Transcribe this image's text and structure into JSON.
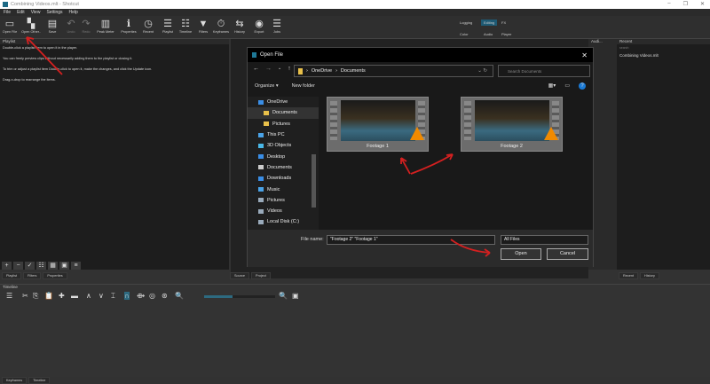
{
  "window": {
    "title": "Combining Videos.mlt - Shotcut",
    "controls": [
      "–",
      "❐",
      "✕"
    ]
  },
  "menu": [
    "File",
    "Edit",
    "View",
    "Settings",
    "Help"
  ],
  "toolbar": [
    {
      "label": "Open File",
      "icon": "▭"
    },
    {
      "label": "Open Other..",
      "icon": "▚"
    },
    {
      "label": "Save",
      "icon": "▤"
    },
    {
      "label": "Undo",
      "icon": "↶",
      "disabled": true
    },
    {
      "label": "Redo",
      "icon": "↷",
      "disabled": true
    },
    {
      "label": "Peak Meter",
      "icon": "▥"
    },
    {
      "label": "Properties",
      "icon": "ℹ"
    },
    {
      "label": "Recent",
      "icon": "◷"
    },
    {
      "label": "Playlist",
      "icon": "☰"
    },
    {
      "label": "Timeline",
      "icon": "☷"
    },
    {
      "label": "Filters",
      "icon": "▼"
    },
    {
      "label": "Keyframes",
      "icon": "⏱"
    },
    {
      "label": "History",
      "icon": "⇆"
    },
    {
      "label": "Export",
      "icon": "◉"
    },
    {
      "label": "Jobs",
      "icon": "☰"
    }
  ],
  "layouts": {
    "row1": [
      "Logging",
      "Editing",
      "FX"
    ],
    "row2": [
      "Color",
      "Audio",
      "Player"
    ],
    "active": "Editing",
    "accent": "#1e5a74"
  },
  "playlist": {
    "title": "Playlist",
    "help": [
      "Double-click a playlist item to open it in the player.",
      "You can freely preview clips without necessarily adding them to the playlist or closing it.",
      "To trim or adjust a playlist item Double-click to open it, make the changes, and click the Update icon.",
      "Drag-n-drop to rearrange the items."
    ],
    "buttons": [
      "+",
      "−",
      "✓",
      "☷",
      "▦",
      "▣",
      "≡"
    ],
    "tabs": [
      "Playlist",
      "Filters",
      "Properties"
    ]
  },
  "player": {
    "tabs": [
      "Source",
      "Project"
    ]
  },
  "audio": {
    "title": "Audi..."
  },
  "recent": {
    "title": "Recent",
    "search_placeholder": "search",
    "items": [
      "Combining Videos.mlt"
    ],
    "tabs": [
      "Recent",
      "History"
    ]
  },
  "timeline": {
    "title": "Timeline",
    "tools": [
      "☰",
      "✂",
      "⎘",
      "📋",
      "✚",
      "▬",
      "∧",
      "∨",
      "⌶",
      "∩",
      "⟴",
      "◎",
      "⊛",
      "🔍",
      "🔍",
      "▣"
    ],
    "zoom_level": 0.4,
    "tabs": [
      "Keyframes",
      "Timeline"
    ]
  },
  "dialog": {
    "title": "Open File",
    "breadcrumb": [
      "OneDrive",
      "Documents"
    ],
    "search_placeholder": "Search Documents",
    "organize": "Organize ▾",
    "new_folder": "New folder",
    "nav": [
      {
        "label": "OneDrive",
        "color": "#3a8ee6"
      },
      {
        "label": "Documents",
        "color": "#e8c04a",
        "selected": true
      },
      {
        "label": "Pictures",
        "color": "#e8c04a"
      },
      {
        "label": "This PC",
        "color": "#4aa3e8"
      },
      {
        "label": "3D Objects",
        "color": "#4ab8e8"
      },
      {
        "label": "Desktop",
        "color": "#3a8ee6"
      },
      {
        "label": "Documents",
        "color": "#ccc"
      },
      {
        "label": "Downloads",
        "color": "#3a8ee6"
      },
      {
        "label": "Music",
        "color": "#4aa3e8"
      },
      {
        "label": "Pictures",
        "color": "#9ab"
      },
      {
        "label": "Videos",
        "color": "#9ab"
      },
      {
        "label": "Local Disk (C:)",
        "color": "#9ab"
      }
    ],
    "files": [
      "Footage 1",
      "Footage 2"
    ],
    "filename_label": "File name:",
    "filename_value": "\"Footage 2\" \"Footage 1\"",
    "filetype": "All Files",
    "open": "Open",
    "cancel": "Cancel"
  }
}
